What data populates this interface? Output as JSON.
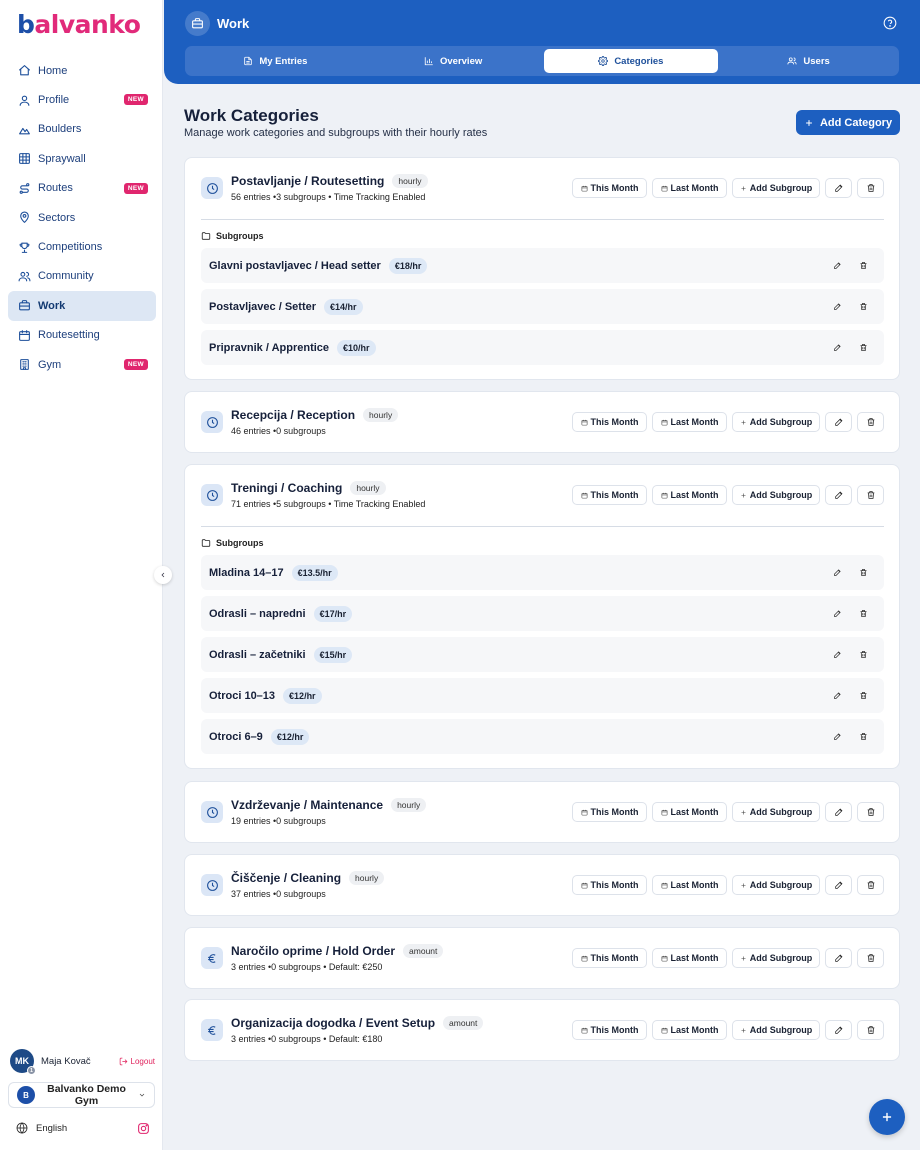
{
  "brand": {
    "logo_text_b": "b",
    "logo_text_rest": "alvanko",
    "accent": "#1d5fc0",
    "pink": "#e0266e"
  },
  "sidebar": {
    "items": [
      {
        "label": "Home",
        "icon": "home-icon",
        "new": false,
        "active": false
      },
      {
        "label": "Profile",
        "icon": "user-icon",
        "new": true,
        "active": false
      },
      {
        "label": "Boulders",
        "icon": "mountain-icon",
        "new": false,
        "active": false
      },
      {
        "label": "Spraywall",
        "icon": "grid-icon",
        "new": false,
        "active": false
      },
      {
        "label": "Routes",
        "icon": "route-icon",
        "new": true,
        "active": false
      },
      {
        "label": "Sectors",
        "icon": "map-pin-icon",
        "new": false,
        "active": false
      },
      {
        "label": "Competitions",
        "icon": "trophy-icon",
        "new": false,
        "active": false
      },
      {
        "label": "Community",
        "icon": "users-icon",
        "new": false,
        "active": false
      },
      {
        "label": "Work",
        "icon": "briefcase-icon",
        "new": false,
        "active": true
      },
      {
        "label": "Routesetting",
        "icon": "calendar-icon",
        "new": false,
        "active": false
      },
      {
        "label": "Gym",
        "icon": "building-icon",
        "new": true,
        "active": false
      }
    ],
    "new_label": "NEW",
    "user": {
      "initials": "MK",
      "badge": "1",
      "name": "Maja Kovač",
      "logout": "Logout"
    },
    "gym": {
      "initial": "B",
      "name": "Balvanko Demo Gym"
    },
    "language": "English"
  },
  "header": {
    "title": "Work",
    "tabs": [
      {
        "label": "My Entries",
        "icon": "file-icon",
        "active": false
      },
      {
        "label": "Overview",
        "icon": "bar-chart-icon",
        "active": false
      },
      {
        "label": "Categories",
        "icon": "gear-icon",
        "active": true
      },
      {
        "label": "Users",
        "icon": "users-icon",
        "active": false
      }
    ]
  },
  "main": {
    "title": "Work Categories",
    "subtitle": "Manage work categories and subgroups with their hourly rates",
    "add_category": "Add Category",
    "buttons": {
      "this_month": "This Month",
      "last_month": "Last Month",
      "add_subgroup": "Add Subgroup"
    },
    "subgroups_label": "Subgroups",
    "categories": [
      {
        "title": "Postavljanje / Routesetting",
        "type": "hourly",
        "icon": "clock-icon",
        "meta": "56 entries •3 subgroups • Time Tracking Enabled",
        "subgroups": [
          {
            "name": "Glavni postavljavec / Head setter",
            "rate": "€18/hr"
          },
          {
            "name": "Postavljavec / Setter",
            "rate": "€14/hr"
          },
          {
            "name": "Pripravnik / Apprentice",
            "rate": "€10/hr"
          }
        ]
      },
      {
        "title": "Recepcija / Reception",
        "type": "hourly",
        "icon": "clock-icon",
        "meta": "46 entries •0 subgroups",
        "subgroups": []
      },
      {
        "title": "Treningi / Coaching",
        "type": "hourly",
        "icon": "clock-icon",
        "meta": "71 entries •5 subgroups • Time Tracking Enabled",
        "subgroups": [
          {
            "name": "Mladina 14–17",
            "rate": "€13.5/hr"
          },
          {
            "name": "Odrasli – napredni",
            "rate": "€17/hr"
          },
          {
            "name": "Odrasli – začetniki",
            "rate": "€15/hr"
          },
          {
            "name": "Otroci 10–13",
            "rate": "€12/hr"
          },
          {
            "name": "Otroci 6–9",
            "rate": "€12/hr"
          }
        ]
      },
      {
        "title": "Vzdrževanje / Maintenance",
        "type": "hourly",
        "icon": "clock-icon",
        "meta": "19 entries •0 subgroups",
        "subgroups": []
      },
      {
        "title": "Čiščenje / Cleaning",
        "type": "hourly",
        "icon": "clock-icon",
        "meta": "37 entries •0 subgroups",
        "subgroups": []
      },
      {
        "title": "Naročilo oprime / Hold Order",
        "type": "amount",
        "icon": "euro-icon",
        "meta": "3 entries •0 subgroups • Default: €250",
        "subgroups": []
      },
      {
        "title": "Organizacija dogodka / Event Setup",
        "type": "amount",
        "icon": "euro-icon",
        "meta": "3 entries •0 subgroups • Default: €180",
        "subgroups": []
      }
    ]
  }
}
